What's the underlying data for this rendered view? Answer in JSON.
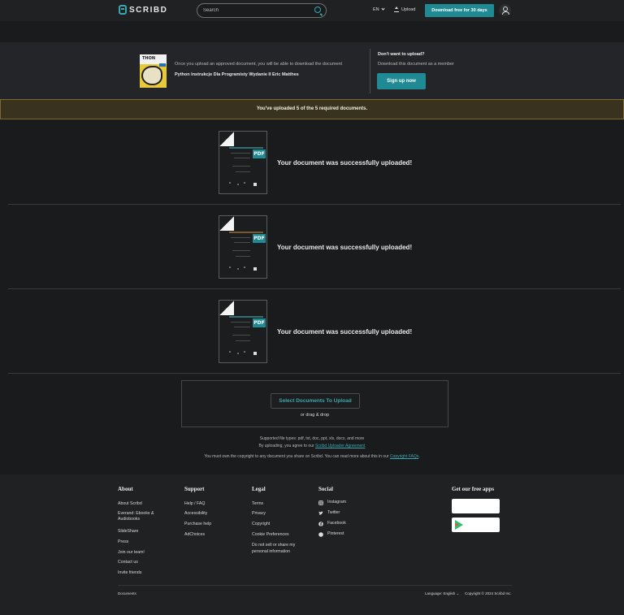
{
  "header": {
    "logo_text": "SCRIBD",
    "search_placeholder": "Search",
    "language": "EN",
    "upload_label": "Upload",
    "cta_label": "Download free for 30 days"
  },
  "promo": {
    "cover_title": "THON",
    "note": "Once you upload an approved document, you will be able to download the document",
    "document_title": "Python Instrukcje Dla Programisty Wydanie II Eric Matthes",
    "right_title": "Don't want to upload?",
    "right_subtitle": "Download this document as a member",
    "signup_label": "Sign up now"
  },
  "notice": "You've uploaded 5 of the 5 required documents.",
  "documents": [
    {
      "badge": "PDF",
      "message": "Your document was successfully uploaded!"
    },
    {
      "badge": "PDF",
      "message": "Your document was successfully uploaded!"
    },
    {
      "badge": "PDF",
      "message": "Your document was successfully uploaded!"
    }
  ],
  "upload": {
    "select_label": "Select Documents To Upload",
    "drag_label": "or drag & drop",
    "supported": "Supported file types: pdf, txt, doc, ppt, xls, docx, and more",
    "agree_prefix": "By uploading, you agree to our",
    "agree_link": "Scribd Uploader Agreement",
    "copyright_prefix": "You must own the copyright to any document you share on Scribd. You can read more about this in our",
    "copyright_link": "Copyright FAQs",
    "copyright_suffix": "."
  },
  "footer": {
    "about": {
      "heading": "About",
      "items": [
        "About Scribd",
        "Everand: Ebooks &",
        "Audiobooks",
        "SlideShare",
        "Press",
        "Join our team!",
        "Contact us",
        "Invite friends"
      ]
    },
    "support": {
      "heading": "Support",
      "items": [
        "Help / FAQ",
        "Accessibility",
        "Purchase help",
        "AdChoices"
      ]
    },
    "legal": {
      "heading": "Legal",
      "items": [
        "Terms",
        "Privacy",
        "Copyright",
        "Cookie Preferences",
        "Do not sell or share my",
        "personal information"
      ]
    },
    "social": {
      "heading": "Social",
      "items": [
        "Instagram",
        "Twitter",
        "Facebook",
        "Pinterest"
      ]
    },
    "apps": {
      "heading": "Get our free apps"
    },
    "bottom_left": "Documents",
    "language_label": "Language: English",
    "copyright": "Copyright © 2024 Scribd Inc."
  }
}
